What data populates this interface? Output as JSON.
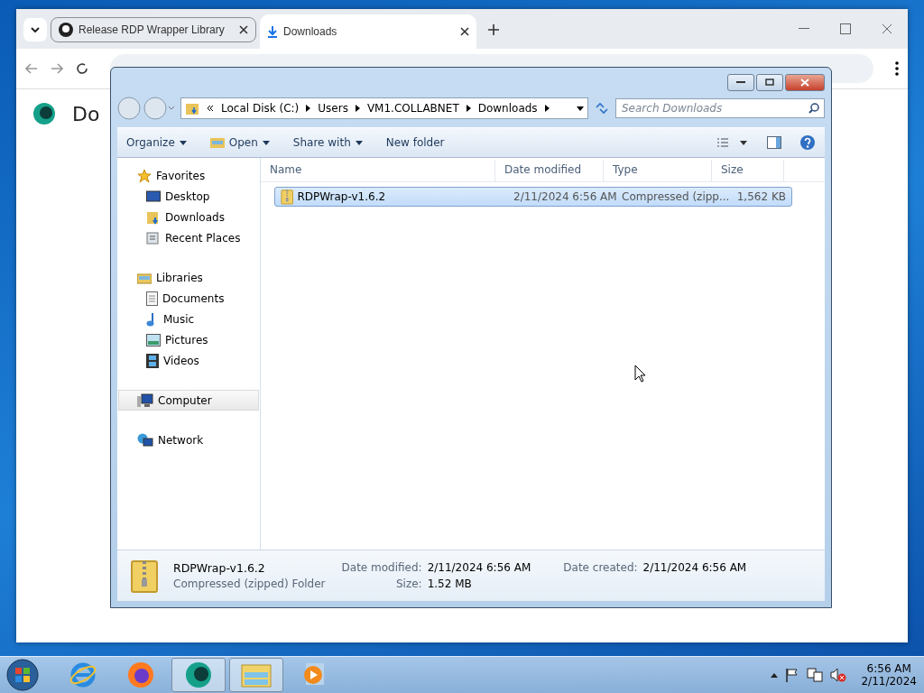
{
  "browser": {
    "tabs": [
      {
        "title": "Release RDP Wrapper Library",
        "selected": false
      },
      {
        "title": "Downloads",
        "selected": true
      }
    ],
    "page_heading": "Do"
  },
  "explorer": {
    "breadcrumb": [
      "Local Disk (C:)",
      "Users",
      "VM1.COLLABNET",
      "Downloads"
    ],
    "search": {
      "placeholder": "Search Downloads"
    },
    "toolbar": [
      {
        "label": "Organize",
        "kind": "menu"
      },
      {
        "label": "Open",
        "kind": "open"
      },
      {
        "label": "Share with",
        "kind": "menu"
      },
      {
        "label": "New folder",
        "kind": "plain"
      }
    ],
    "nav": [
      {
        "label": "Favorites",
        "kind": "star",
        "selected": false,
        "children": [
          {
            "label": "Desktop",
            "kind": "desktop",
            "selected": false
          },
          {
            "label": "Downloads",
            "kind": "downloads",
            "selected": false
          },
          {
            "label": "Recent Places",
            "kind": "recent",
            "selected": false
          }
        ]
      },
      {
        "label": "Libraries",
        "kind": "library",
        "selected": false,
        "children": [
          {
            "label": "Documents",
            "kind": "documents",
            "selected": false
          },
          {
            "label": "Music",
            "kind": "music",
            "selected": false
          },
          {
            "label": "Pictures",
            "kind": "pictures",
            "selected": false
          },
          {
            "label": "Videos",
            "kind": "videos",
            "selected": false
          }
        ]
      },
      {
        "label": "Computer",
        "kind": "computer",
        "selected": true
      },
      {
        "label": "Network",
        "kind": "network",
        "selected": false
      }
    ],
    "columns": [
      "Name",
      "Date modified",
      "Type",
      "Size"
    ],
    "files": [
      {
        "name": "RDPWrap-v1.6.2",
        "date": "2/11/2024 6:56 AM",
        "type": "Compressed (zipp...",
        "size": "1,562 KB",
        "selected": true
      }
    ],
    "details": {
      "name": "RDPWrap-v1.6.2",
      "type": "Compressed (zipped) Folder",
      "fields": [
        {
          "label": "Date modified:",
          "value": "2/11/2024 6:56 AM"
        },
        {
          "label": "Size:",
          "value": "1.52 MB"
        },
        {
          "label": "Date created:",
          "value": "2/11/2024 6:56 AM"
        }
      ]
    }
  },
  "taskbar": {
    "apps": [
      {
        "kind": "ie",
        "active": false
      },
      {
        "kind": "firefox",
        "active": false
      },
      {
        "kind": "supermium",
        "active": true
      },
      {
        "kind": "explorer",
        "active": true
      },
      {
        "kind": "media",
        "active": false
      }
    ],
    "clock": {
      "time": "6:56 AM",
      "date": "2/11/2024"
    }
  }
}
